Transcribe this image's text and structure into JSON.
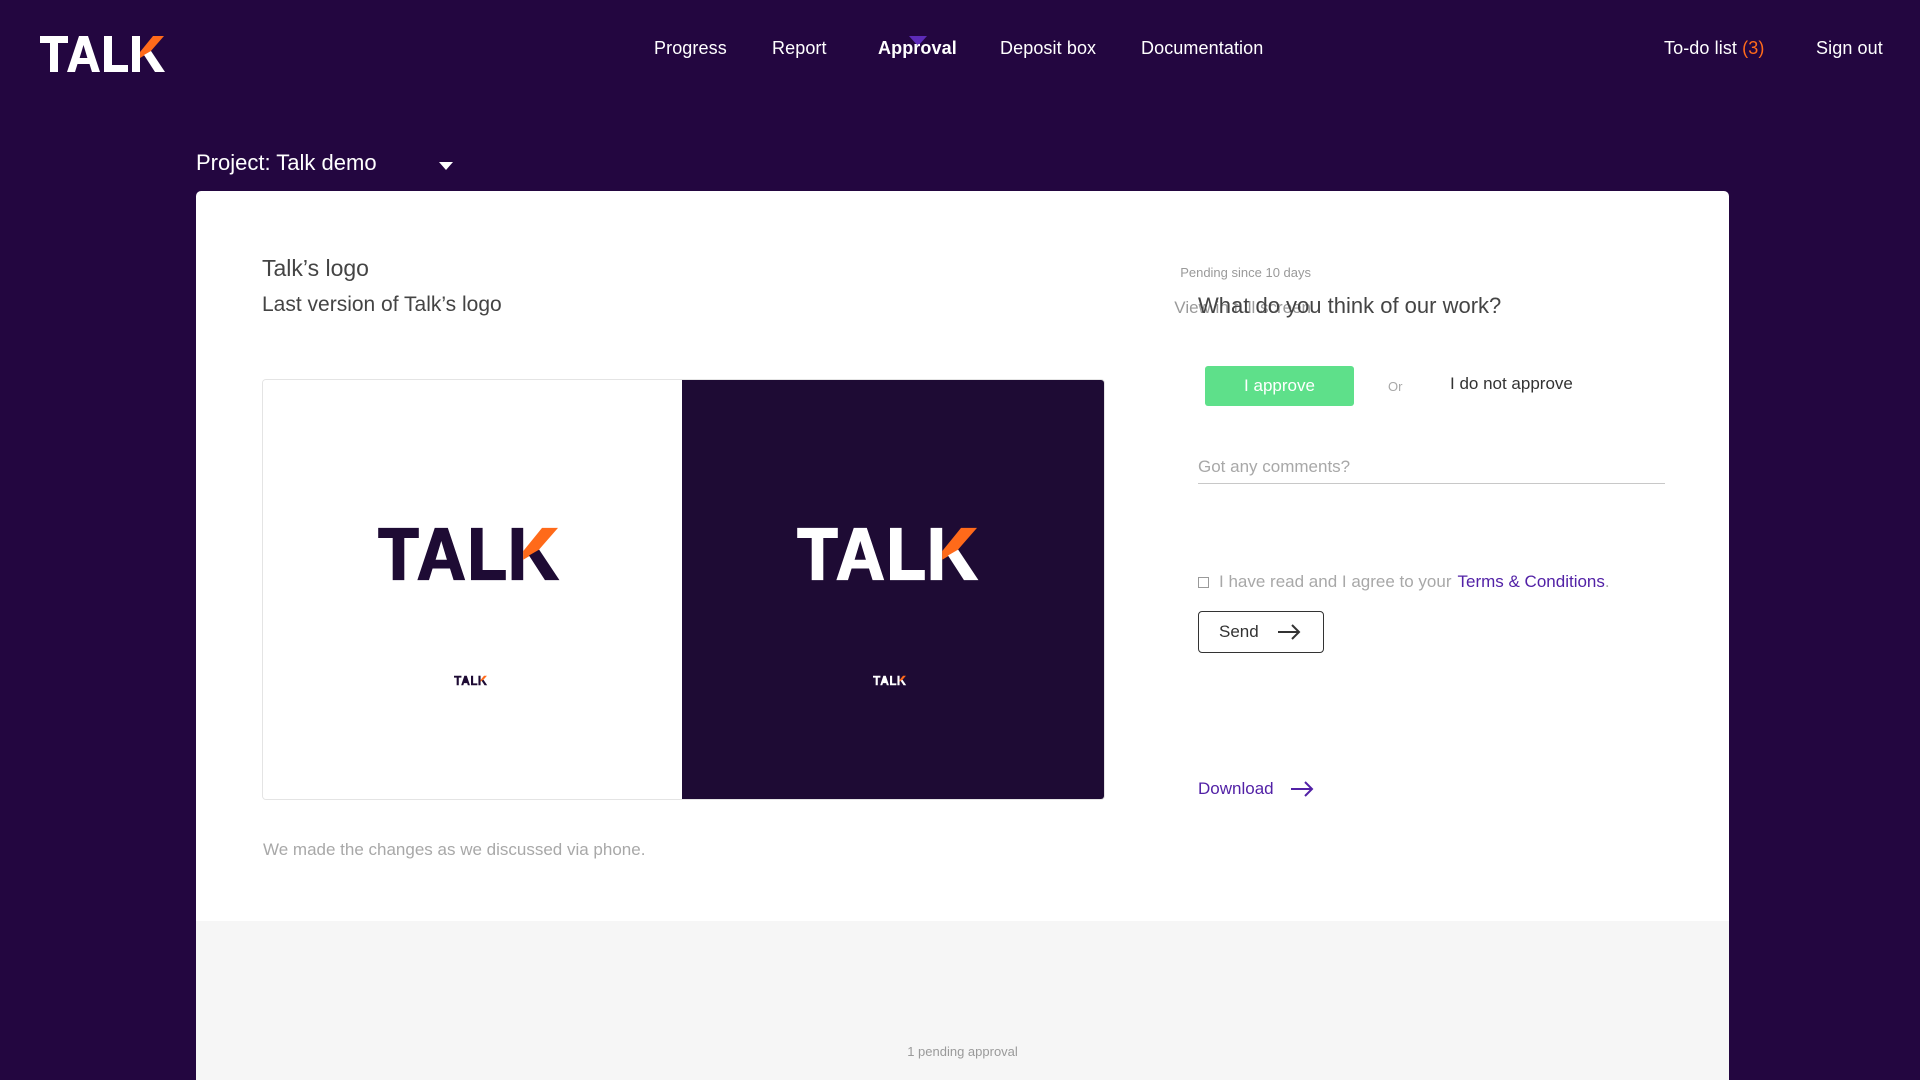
{
  "brand": {
    "logo_text": "TALK",
    "colors": {
      "primary": "#230640",
      "accent": "#ff6a1a",
      "white": "#ffffff",
      "dark_panel": "#1e0b34",
      "approve_green": "#5ee08a",
      "link_purple": "#5221a6"
    }
  },
  "nav": {
    "items": [
      {
        "label": "Progress"
      },
      {
        "label": "Report"
      },
      {
        "label": "Approval",
        "active": true
      },
      {
        "label": "Deposit box"
      },
      {
        "label": "Documentation"
      }
    ],
    "todo_label": "To-do list",
    "todo_count": "(3)",
    "signout_label": "Sign out"
  },
  "project": {
    "label": "Project: Talk demo",
    "icon": "chevron-down-icon"
  },
  "asset": {
    "title": "Talk’s logo",
    "subtitle": "Last version of Talk’s logo",
    "pending_since": "Pending since 10 days",
    "fullscreen_label": "View in full screen",
    "caption": "We made the changes as we discussed via phone."
  },
  "review": {
    "question": "What do you think of our work?",
    "approve_label": "I approve",
    "or_label": "Or",
    "disapprove_label": "I do not approve",
    "comments_placeholder": "Got any comments?",
    "terms_text": "I have read and I agree to your",
    "terms_link": "Terms & Conditions",
    "terms_end": ".",
    "send_label": "Send",
    "download_label": "Download"
  },
  "footer": {
    "pending_text": "1 pending approval"
  }
}
